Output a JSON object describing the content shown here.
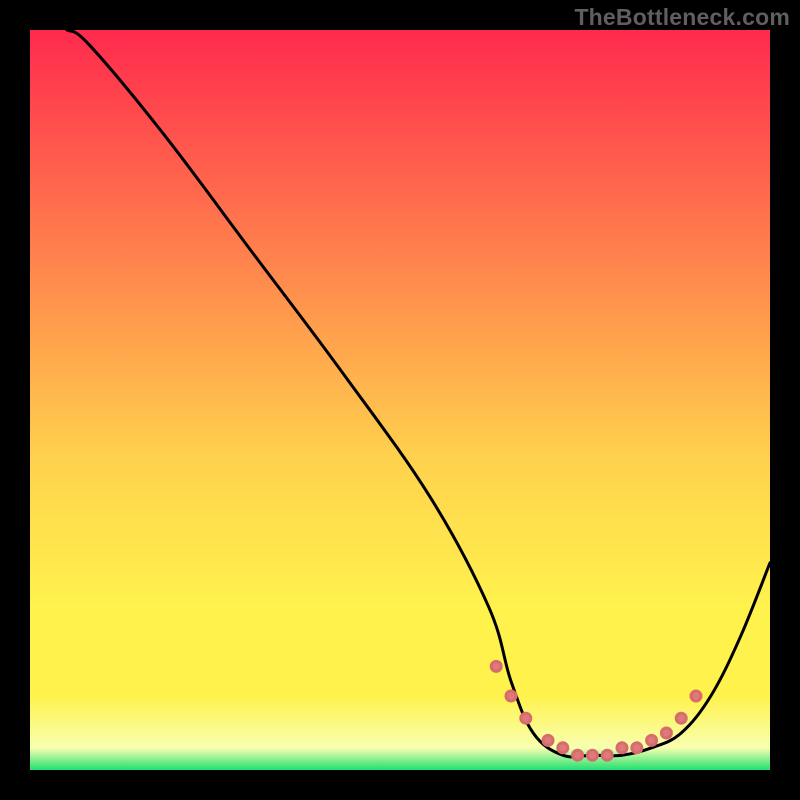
{
  "watermark": "TheBottleneck.com",
  "colors": {
    "background": "#000000",
    "watermark_text": "#5f5f5f",
    "curve": "#000000",
    "marker_fill_outer": "#d86b6b",
    "marker_fill_inner": "#de7a7a",
    "axis": "#000000",
    "gradient_top": "#ff2a4d",
    "gradient_mid1": "#ff804d",
    "gradient_mid2": "#ffd24d",
    "gradient_mid3": "#fff24d",
    "gradient_pale": "#f8ffb0",
    "gradient_green": "#20e070"
  },
  "chart_data": {
    "type": "line",
    "title": "",
    "xlabel": "",
    "ylabel": "",
    "xlim": [
      0,
      100
    ],
    "ylim": [
      0,
      100
    ],
    "series": [
      {
        "name": "bottleneck-curve",
        "x": [
          5,
          8,
          18,
          30,
          42,
          54,
          62,
          65,
          68,
          72,
          76,
          80,
          84,
          88,
          92,
          96,
          100
        ],
        "values": [
          100,
          98,
          86,
          70,
          54,
          37,
          22,
          12,
          5,
          2,
          2,
          2,
          3,
          5,
          10,
          18,
          28
        ]
      }
    ],
    "markers": {
      "name": "highlight-range",
      "x": [
        63,
        65,
        67,
        70,
        72,
        74,
        76,
        78,
        80,
        82,
        84,
        86,
        88,
        90
      ],
      "values": [
        14,
        10,
        7,
        4,
        3,
        2,
        2,
        2,
        3,
        3,
        4,
        5,
        7,
        10
      ]
    }
  }
}
